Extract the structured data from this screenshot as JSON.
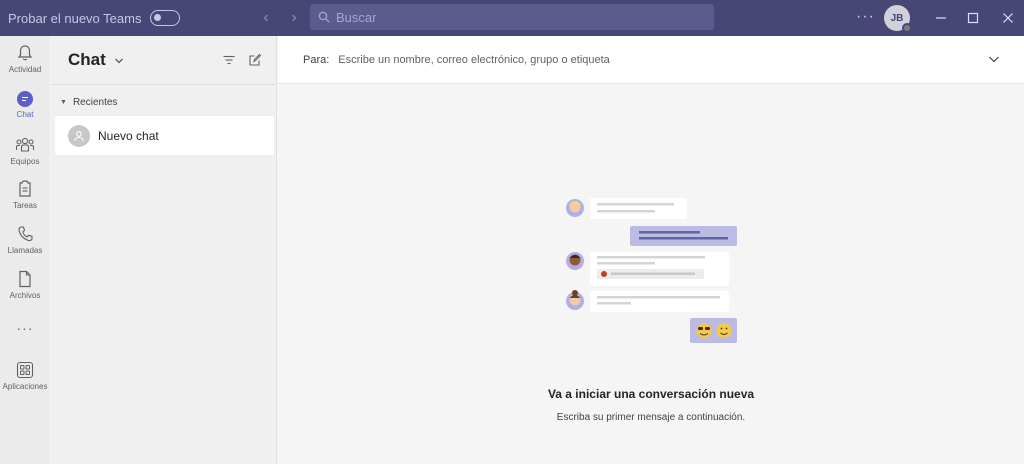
{
  "titlebar": {
    "try_new_label": "Probar el nuevo Teams",
    "search_placeholder": "Buscar",
    "more_label": "···",
    "user_initials": "JB"
  },
  "rail": {
    "items": [
      {
        "label": "Actividad",
        "icon": "bell-icon"
      },
      {
        "label": "Chat",
        "icon": "chat-icon",
        "active": true
      },
      {
        "label": "Equipos",
        "icon": "teams-icon"
      },
      {
        "label": "Tareas",
        "icon": "tasks-icon"
      },
      {
        "label": "Llamadas",
        "icon": "phone-icon"
      },
      {
        "label": "Archivos",
        "icon": "file-icon"
      },
      {
        "label": "···",
        "icon": "more-icon"
      },
      {
        "label": "Aplicaciones",
        "icon": "apps-icon"
      }
    ]
  },
  "chat_panel": {
    "title": "Chat",
    "section_label": "Recientes",
    "items": [
      {
        "name": "Nuevo chat"
      }
    ]
  },
  "main": {
    "to_label": "Para:",
    "to_placeholder": "Escribe un nombre, correo electrónico, grupo o etiqueta",
    "empty_title": "Va a iniciar una conversación nueva",
    "empty_subtitle": "Escriba su primer mensaje a continuación."
  },
  "colors": {
    "titlebar": "#464775",
    "accent": "#5b5fc7",
    "rail_bg": "#ebebeb",
    "panel_bg": "#f0f0f0"
  }
}
